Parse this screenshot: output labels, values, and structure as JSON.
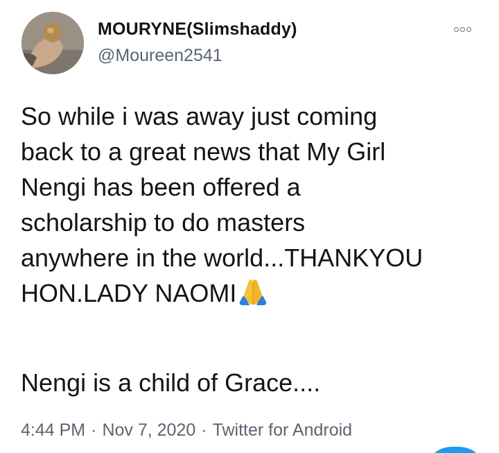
{
  "tweet": {
    "display_name": "MOURYNE(Slimshaddy)",
    "handle": "@Moureen2541",
    "more_icon": "more-options-icon",
    "text_lines": [
      "So while i was away just coming",
      "back to a great news that My Girl",
      "Nengi has been offered a",
      "scholarship to do masters",
      "anywhere in the world...THANKYOU",
      "HON.LADY NAOMI"
    ],
    "emoji": "folded-hands-icon",
    "second_paragraph": "Nengi is a child of Grace....",
    "time": "4:44 PM",
    "date": "Nov 7, 2020",
    "source": "Twitter for Android",
    "separator": "·"
  },
  "colors": {
    "text": "#141414",
    "secondary": "#5b6570",
    "accent": "#1d9bf0"
  }
}
